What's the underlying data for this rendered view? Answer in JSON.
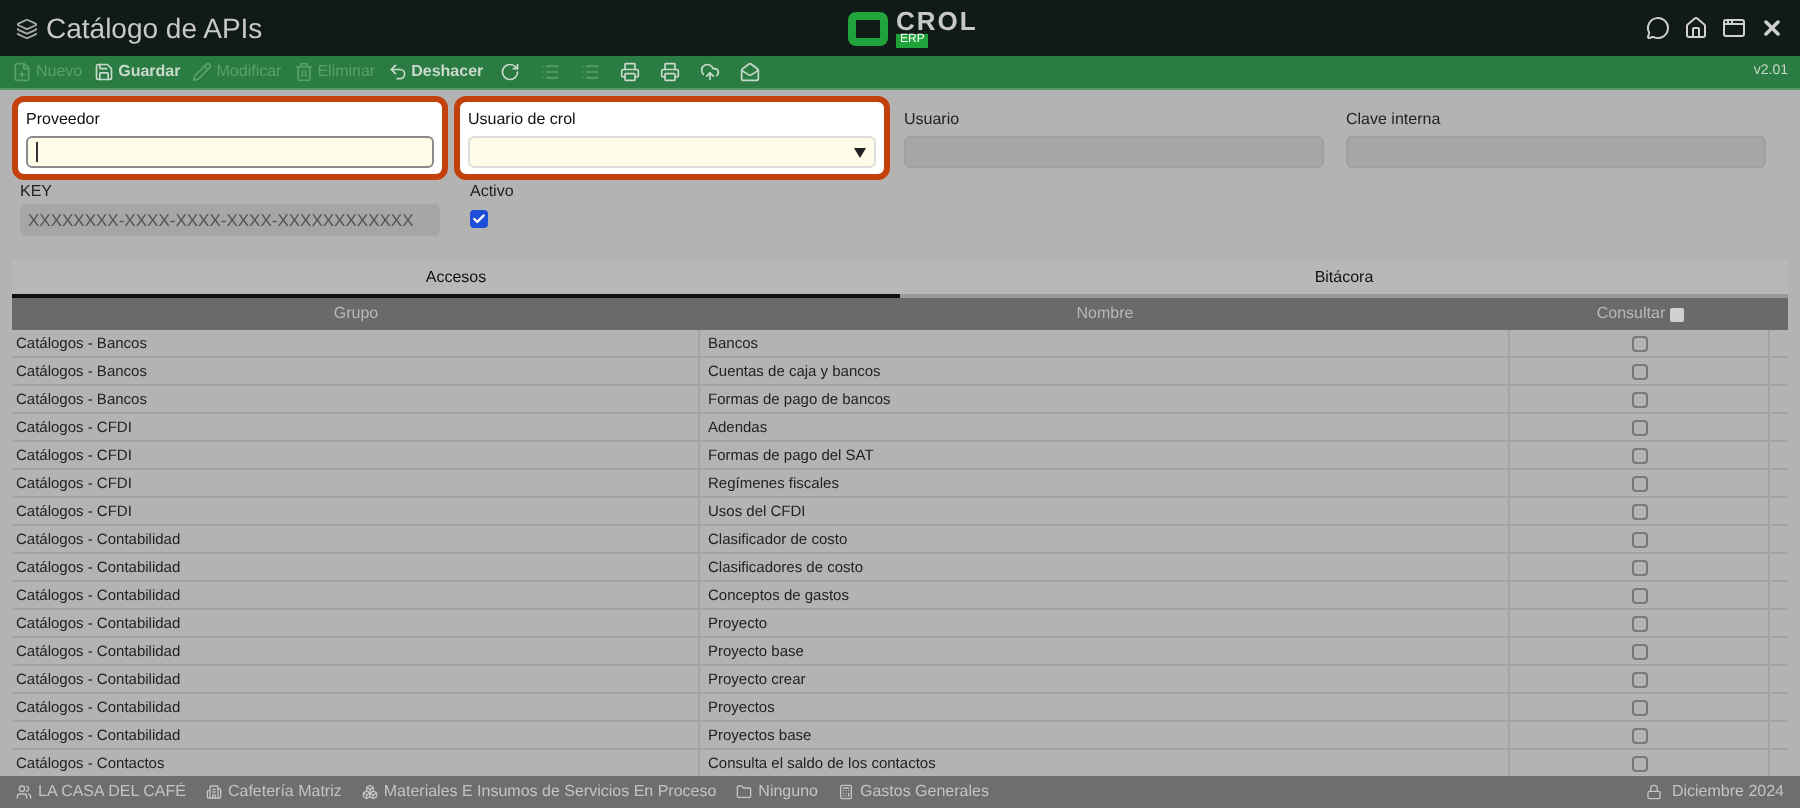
{
  "window": {
    "title": "Catálogo de APIs",
    "logo": {
      "name": "CROL",
      "sub": "ERP"
    },
    "version": "v2.01"
  },
  "toolbar": [
    {
      "kind": "new",
      "label": "Nuevo",
      "disabled": true
    },
    {
      "kind": "save",
      "label": "Guardar",
      "disabled": false
    },
    {
      "kind": "edit",
      "label": "Modificar",
      "disabled": true
    },
    {
      "kind": "delete",
      "label": "Eliminar",
      "disabled": true
    },
    {
      "kind": "undo",
      "label": "Deshacer",
      "disabled": false
    },
    {
      "kind": "refresh",
      "disabled": false
    },
    {
      "kind": "list",
      "disabled": true
    },
    {
      "kind": "list",
      "disabled": true
    },
    {
      "kind": "print",
      "disabled": false
    },
    {
      "kind": "print2",
      "disabled": false
    },
    {
      "kind": "upload",
      "disabled": false
    },
    {
      "kind": "mail",
      "disabled": false
    }
  ],
  "form": {
    "fields": [
      {
        "label": "Proveedor",
        "kind": "text",
        "highlighted": true,
        "focused": true
      },
      {
        "label": "Usuario de crol",
        "kind": "select",
        "highlighted": true,
        "focused": false
      },
      {
        "label": "Usuario",
        "kind": "text",
        "highlighted": false,
        "focused": false
      },
      {
        "label": "Clave interna",
        "kind": "text",
        "highlighted": false,
        "focused": false
      }
    ],
    "key": {
      "label": "KEY",
      "value": "XXXXXXXX-XXXX-XXXX-XXXX-XXXXXXXXXXXX"
    },
    "active": {
      "label": "Activo",
      "checked": true
    }
  },
  "tabs": [
    {
      "label": "Accesos",
      "selected": true
    },
    {
      "label": "Bitácora",
      "selected": false
    }
  ],
  "table": {
    "columns": [
      "Grupo",
      "Nombre",
      "Consultar"
    ],
    "header_checked": false,
    "rows": [
      {
        "group": "Catálogos - Bancos",
        "name": "Bancos",
        "checked": false
      },
      {
        "group": "Catálogos - Bancos",
        "name": "Cuentas de caja y bancos",
        "checked": false
      },
      {
        "group": "Catálogos - Bancos",
        "name": "Formas de pago de bancos",
        "checked": false
      },
      {
        "group": "Catálogos - CFDI",
        "name": "Adendas",
        "checked": false
      },
      {
        "group": "Catálogos - CFDI",
        "name": "Formas de pago del SAT",
        "checked": false
      },
      {
        "group": "Catálogos - CFDI",
        "name": "Regímenes fiscales",
        "checked": false
      },
      {
        "group": "Catálogos - CFDI",
        "name": "Usos del CFDI",
        "checked": false
      },
      {
        "group": "Catálogos - Contabilidad",
        "name": "Clasificador de costo",
        "checked": false
      },
      {
        "group": "Catálogos - Contabilidad",
        "name": "Clasificadores de costo",
        "checked": false
      },
      {
        "group": "Catálogos - Contabilidad",
        "name": "Conceptos de gastos",
        "checked": false
      },
      {
        "group": "Catálogos - Contabilidad",
        "name": "Proyecto",
        "checked": false
      },
      {
        "group": "Catálogos - Contabilidad",
        "name": "Proyecto base",
        "checked": false
      },
      {
        "group": "Catálogos - Contabilidad",
        "name": "Proyecto crear",
        "checked": false
      },
      {
        "group": "Catálogos - Contabilidad",
        "name": "Proyectos",
        "checked": false
      },
      {
        "group": "Catálogos - Contabilidad",
        "name": "Proyectos base",
        "checked": false
      },
      {
        "group": "Catálogos - Contactos",
        "name": "Consulta el saldo de los contactos",
        "checked": false
      }
    ]
  },
  "status_bar": {
    "items": [
      {
        "kind": "company",
        "label": "LA CASA DEL CAFÉ"
      },
      {
        "kind": "branch",
        "label": "Cafetería Matriz"
      },
      {
        "kind": "warehouse",
        "label": "Materiales E Insumos de Servicios En Proceso"
      },
      {
        "kind": "folder",
        "label": "Ninguno"
      },
      {
        "kind": "register",
        "label": "Gastos Generales"
      }
    ],
    "period": "Diciembre 2024"
  }
}
